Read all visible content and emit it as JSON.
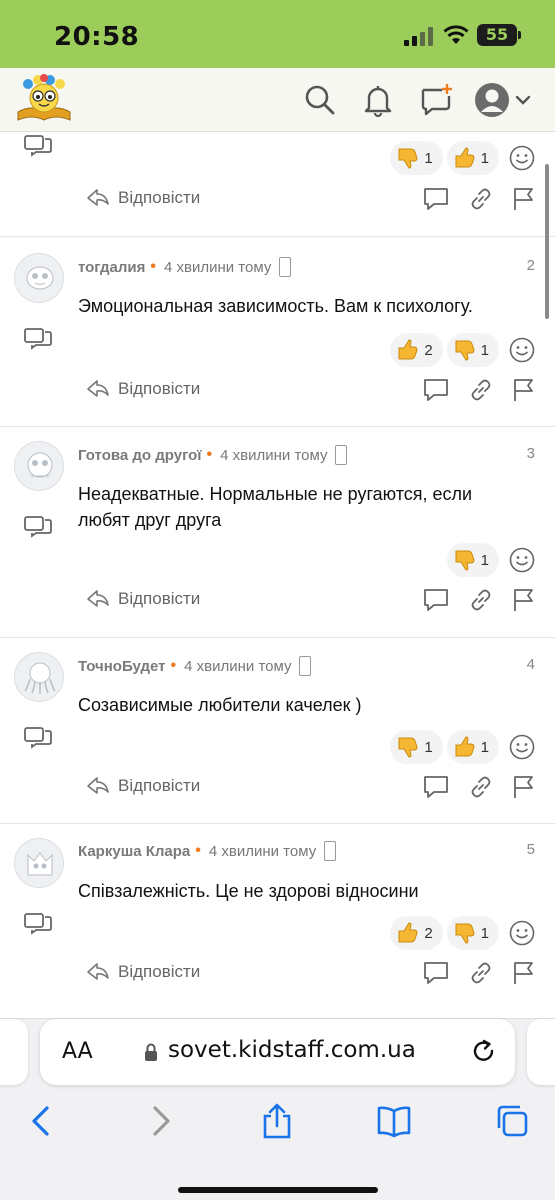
{
  "status_bar": {
    "time": "20:58",
    "battery": "55"
  },
  "browser": {
    "url": "sovet.kidstaff.com.ua",
    "text_size_label": "AA"
  },
  "reply_label": "Відповісти",
  "top_partial": {
    "reactions": [
      {
        "type": "dislike",
        "count": "1"
      },
      {
        "type": "like",
        "count": "1"
      }
    ]
  },
  "comments": [
    {
      "author": "тогдалия",
      "time": "4 хвилини тому",
      "number": "2",
      "text": "Эмоциональная зависимость. Вам к психологу.",
      "reactions": [
        {
          "type": "like",
          "count": "2"
        },
        {
          "type": "dislike",
          "count": "1"
        }
      ]
    },
    {
      "author": "Готова до другої",
      "time": "4 хвилини тому",
      "number": "3",
      "text": "Неадекватные. Нормальные не ругаются, если любят друг друга",
      "reactions": [
        {
          "type": "dislike",
          "count": "1"
        }
      ]
    },
    {
      "author": "ТочноБудет",
      "time": "4 хвилини тому",
      "number": "4",
      "text": "Созависимые любители качелек )",
      "reactions": [
        {
          "type": "dislike",
          "count": "1"
        },
        {
          "type": "like",
          "count": "1"
        }
      ]
    },
    {
      "author": "Каркуша Клара",
      "time": "4 хвилини тому",
      "number": "5",
      "text": "Співзалежність. Це не здорові відносини",
      "reactions": [
        {
          "type": "like",
          "count": "2"
        },
        {
          "type": "dislike",
          "count": "1"
        }
      ]
    }
  ],
  "colors": {
    "status_bar": "#9ccc5a",
    "accent_dot": "#f07a1e",
    "thumb_fill": "#f5b731"
  }
}
